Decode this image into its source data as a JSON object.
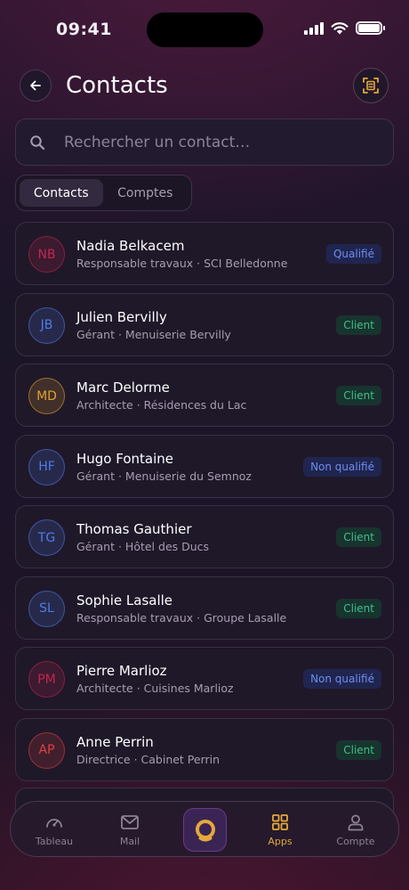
{
  "status_bar": {
    "time": "09:41"
  },
  "header": {
    "title": "Contacts",
    "back_icon": "arrow-left-icon",
    "scan_icon": "scan-icon"
  },
  "search": {
    "placeholder": "Rechercher un contact…",
    "value": ""
  },
  "segments": {
    "active": "Contacts",
    "inactive": "Comptes"
  },
  "contacts": [
    {
      "initials": "NB",
      "name": "Nadia Belkacem",
      "subtitle": "Responsable travaux · SCI Belledonne",
      "status": "Qualifié",
      "kind": "qualif",
      "color": "#c0264f"
    },
    {
      "initials": "JB",
      "name": "Julien Bervilly",
      "subtitle": "Gérant · Menuiserie Bervilly",
      "status": "Client",
      "kind": "client",
      "color": "#4f7be8"
    },
    {
      "initials": "MD",
      "name": "Marc Delorme",
      "subtitle": "Architecte · Résidences du Lac",
      "status": "Client",
      "kind": "client",
      "color": "#e0a030"
    },
    {
      "initials": "HF",
      "name": "Hugo Fontaine",
      "subtitle": "Gérant · Menuiserie du Semnoz",
      "status": "Non qualifié",
      "kind": "qualif",
      "color": "#4f7be8"
    },
    {
      "initials": "TG",
      "name": "Thomas Gauthier",
      "subtitle": "Gérant · Hôtel des Ducs",
      "status": "Client",
      "kind": "client",
      "color": "#4f7be8"
    },
    {
      "initials": "SL",
      "name": "Sophie Lasalle",
      "subtitle": "Responsable travaux · Groupe Lasalle",
      "status": "Client",
      "kind": "client",
      "color": "#4f7be8"
    },
    {
      "initials": "PM",
      "name": "Pierre Marlioz",
      "subtitle": "Architecte · Cuisines Marlioz",
      "status": "Non qualifié",
      "kind": "qualif",
      "color": "#c0264f"
    },
    {
      "initials": "AP",
      "name": "Anne Perrin",
      "subtitle": "Directrice · Cabinet Perrin",
      "status": "Client",
      "kind": "client",
      "color": "#e04040"
    }
  ],
  "tabbar": {
    "tabs": [
      {
        "label": "Tableau",
        "icon": "gauge-icon"
      },
      {
        "label": "Mail",
        "icon": "mail-icon"
      },
      {
        "label": "Apps",
        "icon": "grid-icon",
        "active": true
      },
      {
        "label": "Compte",
        "icon": "user-icon"
      }
    ],
    "center_icon": "app-logo-icon",
    "accent": "#e5a83a"
  }
}
